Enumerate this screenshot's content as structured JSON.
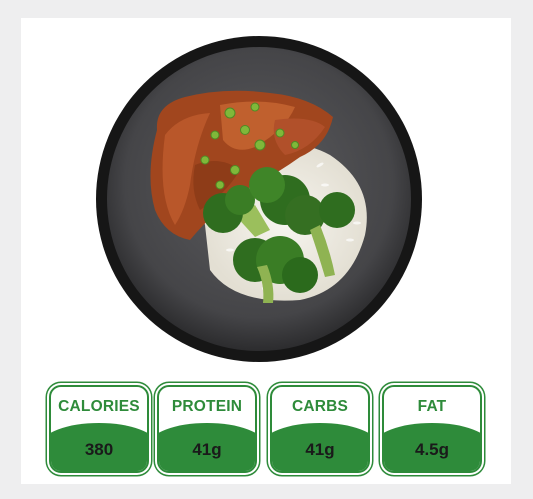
{
  "nutrition": [
    {
      "label": "CALORIES",
      "value": "380"
    },
    {
      "label": "PROTEIN",
      "value": "41g"
    },
    {
      "label": "CARBS",
      "value": "41g"
    },
    {
      "label": "FAT",
      "value": "4.5g"
    }
  ],
  "colors": {
    "accent": "#2e8b3a",
    "page_bg": "#eeeeef",
    "card_bg": "#ffffff"
  },
  "image": {
    "subject": "meal-bowl"
  }
}
